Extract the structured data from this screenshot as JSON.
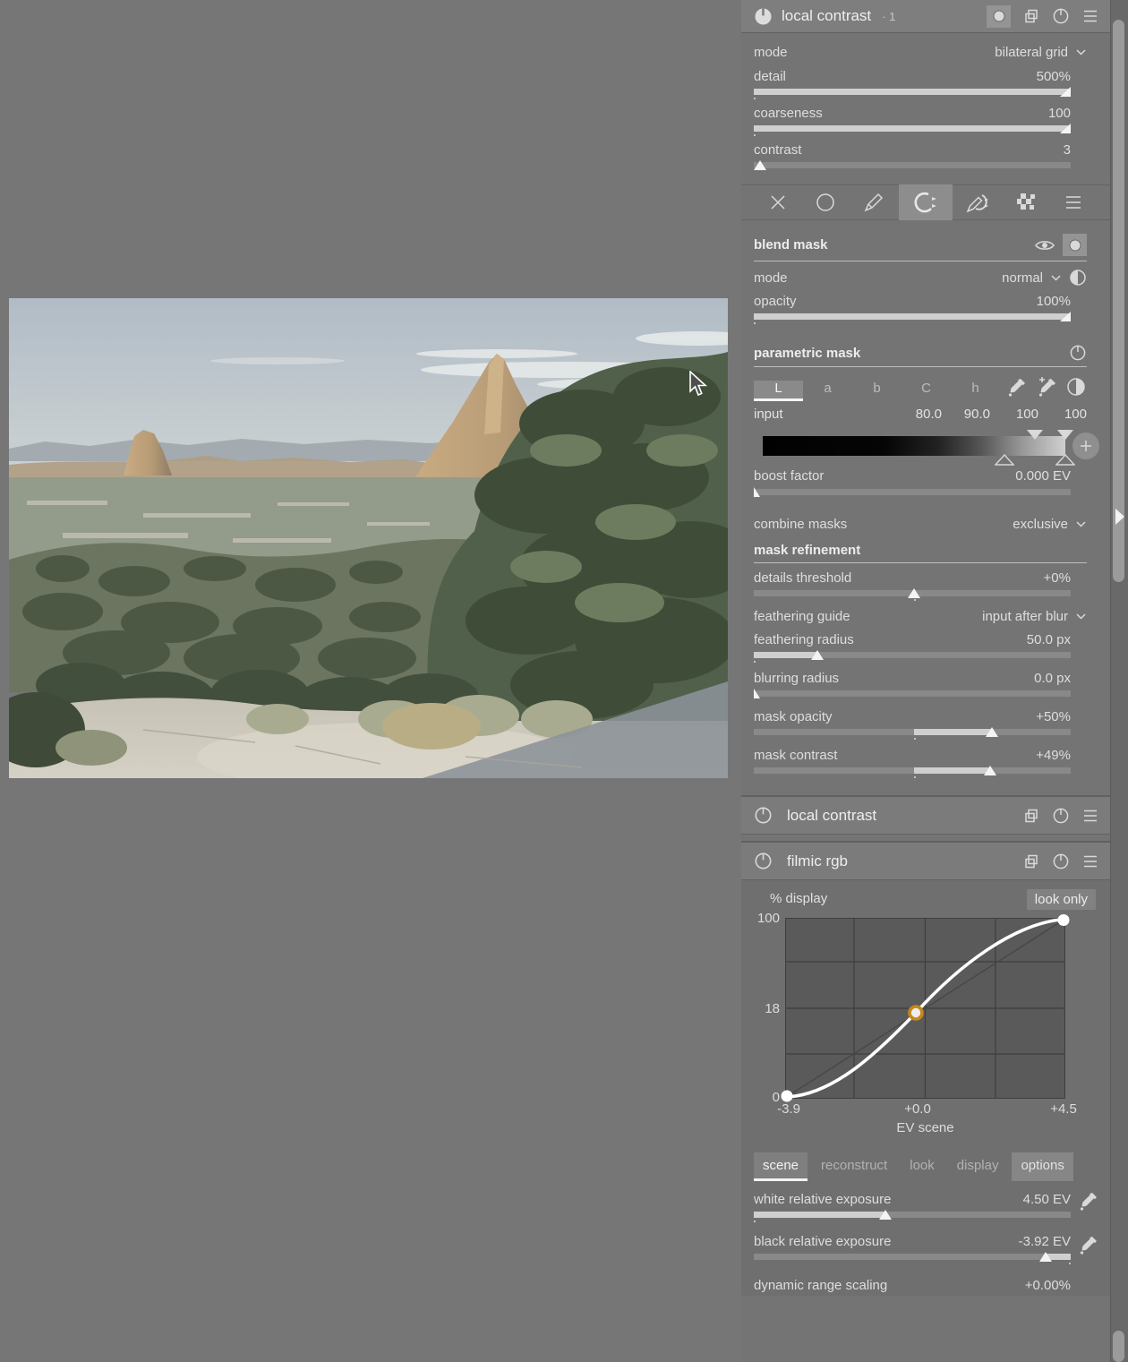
{
  "top_module": {
    "title": "local contrast",
    "instance_suffix": "· 1",
    "mode_label": "mode",
    "mode_value": "bilateral grid",
    "detail_label": "detail",
    "detail_value": "500%",
    "coarseness_label": "coarseness",
    "coarseness_value": "100",
    "contrast_label": "contrast",
    "contrast_value": "3"
  },
  "blend": {
    "title": "blend mask",
    "mode_label": "mode",
    "mode_value": "normal",
    "opacity_label": "opacity",
    "opacity_value": "100%"
  },
  "parametric": {
    "title": "parametric mask",
    "channels": [
      "L",
      "a",
      "b",
      "C",
      "h"
    ],
    "input_label": "input",
    "input_values": [
      "80.0",
      "90.0",
      "100",
      "100"
    ],
    "boost_label": "boost factor",
    "boost_value": "0.000 EV"
  },
  "combine": {
    "label": "combine masks",
    "value": "exclusive"
  },
  "refine": {
    "title": "mask refinement",
    "details_threshold_label": "details threshold",
    "details_threshold_value": "+0%",
    "feathering_guide_label": "feathering guide",
    "feathering_guide_value": "input after blur",
    "feathering_radius_label": "feathering radius",
    "feathering_radius_value": "50.0 px",
    "blurring_radius_label": "blurring radius",
    "blurring_radius_value": "0.0 px",
    "mask_opacity_label": "mask opacity",
    "mask_opacity_value": "+50%",
    "mask_contrast_label": "mask contrast",
    "mask_contrast_value": "+49%"
  },
  "collapsed_modules": [
    {
      "title": "local contrast"
    },
    {
      "title": "filmic rgb"
    }
  ],
  "filmic": {
    "graph": {
      "y_axis_label": "% display",
      "badge": "look only",
      "y_ticks": [
        "100",
        "18",
        "0"
      ],
      "x_ticks": [
        "-3.9",
        "+0.0",
        "+4.5"
      ],
      "x_axis_label": "EV scene",
      "node_ring_color": "#c8861b",
      "curve_color": "#ffffff",
      "chart_data": {
        "type": "line",
        "x_label": "EV scene",
        "y_label": "% display",
        "points": [
          {
            "x": -3.9,
            "y": 0
          },
          {
            "x": 0.0,
            "y": 18
          },
          {
            "x": 4.5,
            "y": 100
          }
        ],
        "xlim": [
          -3.9,
          4.5
        ],
        "ylim": [
          0,
          100
        ]
      }
    },
    "tabs": [
      "scene",
      "reconstruct",
      "look",
      "display",
      "options"
    ],
    "active_tab": "scene",
    "white_label": "white relative exposure",
    "white_value": "4.50 EV",
    "black_label": "black relative exposure",
    "black_value": "-3.92 EV",
    "drs_label": "dynamic range scaling",
    "drs_value": "+0.00%"
  }
}
